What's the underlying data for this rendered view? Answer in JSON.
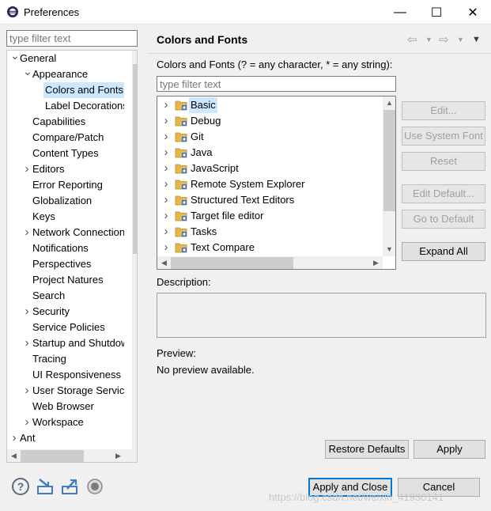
{
  "window": {
    "title": "Preferences",
    "minimize": "—",
    "maximize": "☐",
    "close": "✕"
  },
  "nav": {
    "filter_placeholder": "type filter text",
    "items": [
      {
        "label": "General",
        "level": 0,
        "toggle": "expanded"
      },
      {
        "label": "Appearance",
        "level": 1,
        "toggle": "expanded"
      },
      {
        "label": "Colors and Fonts",
        "level": 2,
        "toggle": "none",
        "selected": true
      },
      {
        "label": "Label Decorations",
        "level": 2,
        "toggle": "none"
      },
      {
        "label": "Capabilities",
        "level": 1,
        "toggle": "none"
      },
      {
        "label": "Compare/Patch",
        "level": 1,
        "toggle": "none"
      },
      {
        "label": "Content Types",
        "level": 1,
        "toggle": "none"
      },
      {
        "label": "Editors",
        "level": 1,
        "toggle": "collapsed"
      },
      {
        "label": "Error Reporting",
        "level": 1,
        "toggle": "none"
      },
      {
        "label": "Globalization",
        "level": 1,
        "toggle": "none"
      },
      {
        "label": "Keys",
        "level": 1,
        "toggle": "none"
      },
      {
        "label": "Network Connections",
        "level": 1,
        "toggle": "collapsed"
      },
      {
        "label": "Notifications",
        "level": 1,
        "toggle": "none"
      },
      {
        "label": "Perspectives",
        "level": 1,
        "toggle": "none"
      },
      {
        "label": "Project Natures",
        "level": 1,
        "toggle": "none"
      },
      {
        "label": "Search",
        "level": 1,
        "toggle": "none"
      },
      {
        "label": "Security",
        "level": 1,
        "toggle": "collapsed"
      },
      {
        "label": "Service Policies",
        "level": 1,
        "toggle": "none"
      },
      {
        "label": "Startup and Shutdown",
        "level": 1,
        "toggle": "collapsed"
      },
      {
        "label": "Tracing",
        "level": 1,
        "toggle": "none"
      },
      {
        "label": "UI Responsiveness",
        "level": 1,
        "toggle": "none"
      },
      {
        "label": "User Storage Service",
        "level": 1,
        "toggle": "collapsed"
      },
      {
        "label": "Web Browser",
        "level": 1,
        "toggle": "none"
      },
      {
        "label": "Workspace",
        "level": 1,
        "toggle": "collapsed"
      },
      {
        "label": "Ant",
        "level": 0,
        "toggle": "collapsed"
      }
    ]
  },
  "page": {
    "title": "Colors and Fonts",
    "instructions": "Colors and Fonts (? = any character, * = any string):",
    "filter_placeholder": "type filter text",
    "categories": [
      {
        "label": "Basic",
        "selected": true
      },
      {
        "label": "Debug"
      },
      {
        "label": "Git"
      },
      {
        "label": "Java"
      },
      {
        "label": "JavaScript"
      },
      {
        "label": "Remote System Explorer"
      },
      {
        "label": "Structured Text Editors"
      },
      {
        "label": "Target file editor"
      },
      {
        "label": "Tasks"
      },
      {
        "label": "Text Compare"
      }
    ],
    "buttons": {
      "edit": "Edit...",
      "use_system_font": "Use System Font",
      "reset": "Reset",
      "edit_default": "Edit Default...",
      "go_to_default": "Go to Default",
      "expand_all": "Expand All"
    },
    "description_label": "Description:",
    "preview_label": "Preview:",
    "preview_text": "No preview available."
  },
  "footer": {
    "restore_defaults": "Restore Defaults",
    "apply": "Apply",
    "apply_and_close": "Apply and Close",
    "cancel": "Cancel",
    "icons": [
      "help-icon",
      "import-icon",
      "export-icon",
      "record-icon"
    ],
    "watermark": "https://blog.csdn.net/weixin_41930141"
  },
  "colors": {
    "selection": "#cce8ff",
    "accent": "#0078d7",
    "folder": "#e8b94a"
  }
}
